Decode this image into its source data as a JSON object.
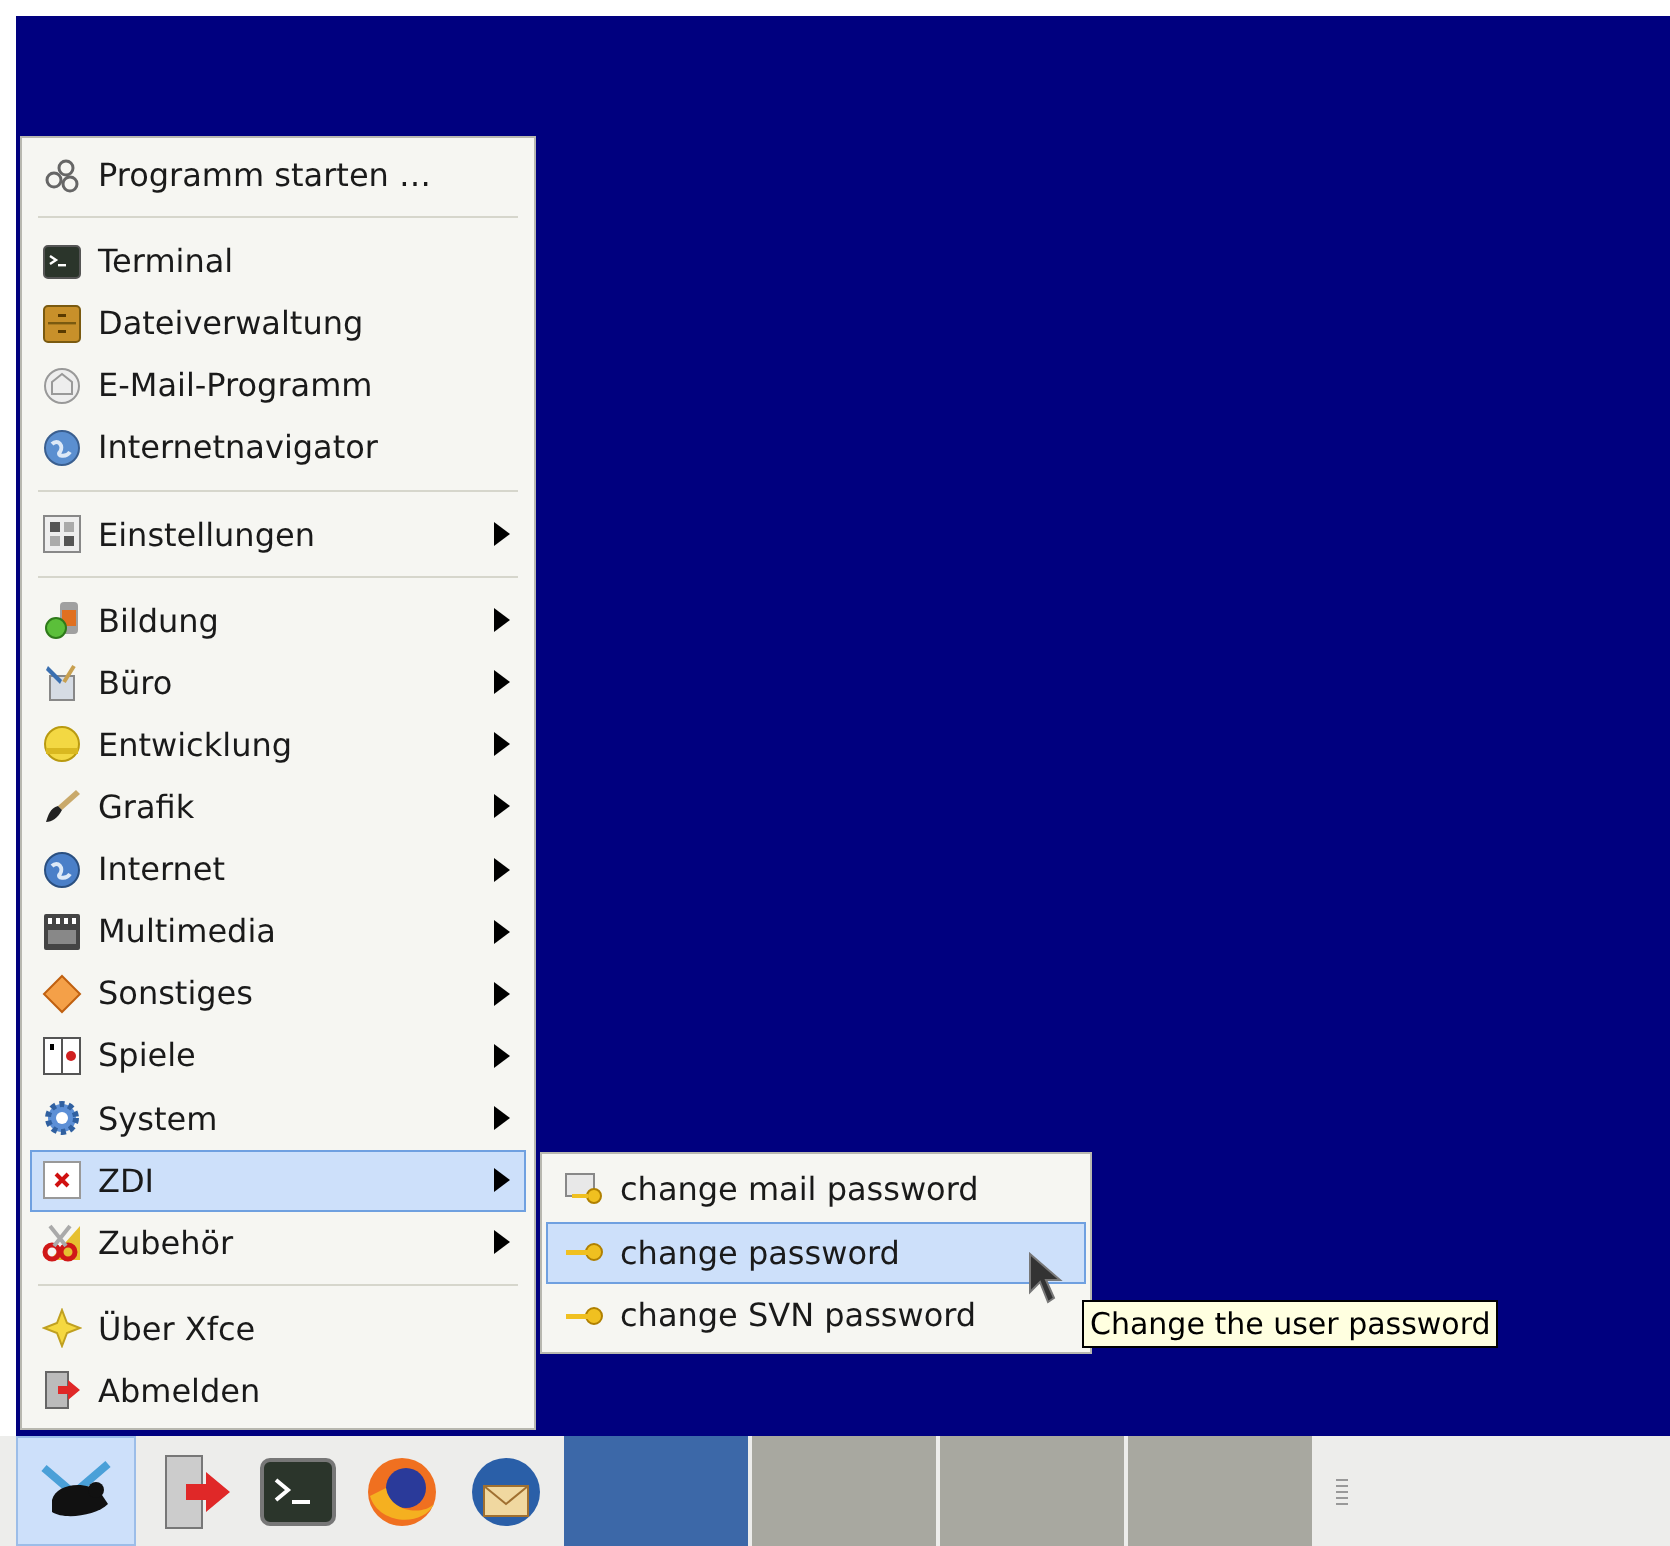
{
  "menu": {
    "items": [
      {
        "kind": "item",
        "label": "Programm starten …",
        "submenu": false,
        "selected": false
      },
      {
        "kind": "separator"
      },
      {
        "kind": "item",
        "label": "Terminal",
        "submenu": false,
        "selected": false
      },
      {
        "kind": "item",
        "label": "Dateiverwaltung",
        "submenu": false,
        "selected": false
      },
      {
        "kind": "item",
        "label": "E-Mail-Programm",
        "submenu": false,
        "selected": false
      },
      {
        "kind": "item",
        "label": "Internetnavigator",
        "submenu": false,
        "selected": false
      },
      {
        "kind": "separator"
      },
      {
        "kind": "item",
        "label": "Einstellungen",
        "submenu": true,
        "selected": false
      },
      {
        "kind": "separator"
      },
      {
        "kind": "item",
        "label": "Bildung",
        "submenu": true,
        "selected": false
      },
      {
        "kind": "item",
        "label": "Büro",
        "submenu": true,
        "selected": false
      },
      {
        "kind": "item",
        "label": "Entwicklung",
        "submenu": true,
        "selected": false
      },
      {
        "kind": "item",
        "label": "Grafik",
        "submenu": true,
        "selected": false
      },
      {
        "kind": "item",
        "label": "Internet",
        "submenu": true,
        "selected": false
      },
      {
        "kind": "item",
        "label": "Multimedia",
        "submenu": true,
        "selected": false
      },
      {
        "kind": "item",
        "label": "Sonstiges",
        "submenu": true,
        "selected": false
      },
      {
        "kind": "item",
        "label": "Spiele",
        "submenu": true,
        "selected": false
      },
      {
        "kind": "item",
        "label": "System",
        "submenu": true,
        "selected": false
      },
      {
        "kind": "item",
        "label": "ZDI",
        "submenu": true,
        "selected": true
      },
      {
        "kind": "item",
        "label": "Zubehör",
        "submenu": true,
        "selected": false
      },
      {
        "kind": "separator"
      },
      {
        "kind": "item",
        "label": "Über Xfce",
        "submenu": false,
        "selected": false
      },
      {
        "kind": "item",
        "label": "Abmelden",
        "submenu": false,
        "selected": false
      }
    ]
  },
  "submenu": {
    "items": [
      {
        "label": "change mail password",
        "selected": false
      },
      {
        "label": "change password",
        "selected": true
      },
      {
        "label": "change SVN password",
        "selected": false
      }
    ]
  },
  "tooltip": {
    "text": "Change the user password"
  },
  "taskbar": {
    "tasks": [
      {
        "selected": true
      },
      {
        "selected": false
      },
      {
        "selected": false
      },
      {
        "selected": false
      }
    ]
  }
}
